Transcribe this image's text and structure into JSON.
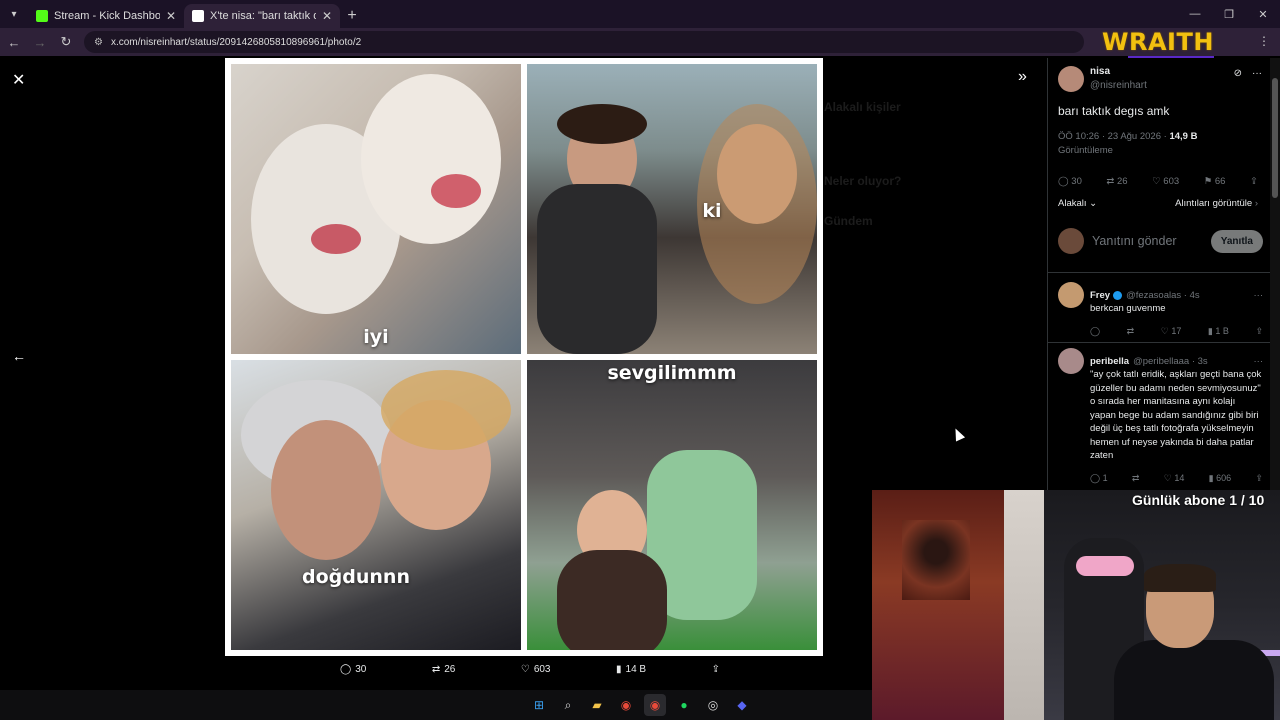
{
  "browser": {
    "tabs": [
      {
        "label": "Stream - Kick Dashboard",
        "favicon_color": "#53fc18"
      },
      {
        "label": "X'te nisa: \"barı taktık degıs amk",
        "favicon_color": "#ffffff"
      }
    ],
    "url": "x.com/nisreinhart/status/2091426805810896961/photo/2",
    "overlay_logo": "WRAITH"
  },
  "viewer": {
    "captions": [
      "iyi",
      "ki",
      "doğdunnn",
      "sevgilimmm"
    ],
    "actions": {
      "replies": "30",
      "reposts": "26",
      "likes": "603",
      "views": "14 B"
    },
    "background_sidebar": [
      "Alakalı kişiler",
      "Neler oluyor?",
      "Gündem"
    ]
  },
  "tweet": {
    "author_name": "nisa",
    "author_handle": "@nisreinhart",
    "text": "barı taktık degıs amk",
    "time": "ÖÖ 10:26 · 23 Ağu 2026 · ",
    "views_count": "14,9 B",
    "views_label": "Görüntüleme",
    "stats": {
      "replies": "30",
      "reposts": "26",
      "likes": "603",
      "bookmarks": "66"
    },
    "sort_label": "Alakalı",
    "quotes_label": "Alıntıları görüntüle",
    "reply_placeholder": "Yanıtını gönder",
    "reply_button": "Yanıtla"
  },
  "replies": [
    {
      "name": "Frey",
      "handle": "@fezasoalas · 4s",
      "text": "berkcan guvenme",
      "stats": {
        "replies": "",
        "reposts": "",
        "likes": "17",
        "views": "1 B"
      }
    },
    {
      "name": "peribella",
      "handle": "@peribellaaa · 3s",
      "text": "\"ay çok tatlı eridik, aşkları geçti bana çok güzeller bu adamı neden sevmiyosunuz\" o sırada her manitasına aynı kolajı yapan bege bu adam sandığınız gibi biri değil üç beş tatlı fotoğrafa yükselmeyin hemen uf neyse yakında bi daha patlar zaten",
      "stats": {
        "replies": "1",
        "reposts": "",
        "likes": "14",
        "views": "606"
      }
    }
  ],
  "stream": {
    "counter": "Günlük abone 1 / 10"
  },
  "colors": {
    "accent": "#1d9bf0",
    "brand_overlay": "#f2c010",
    "kick_green": "#53fc18"
  }
}
